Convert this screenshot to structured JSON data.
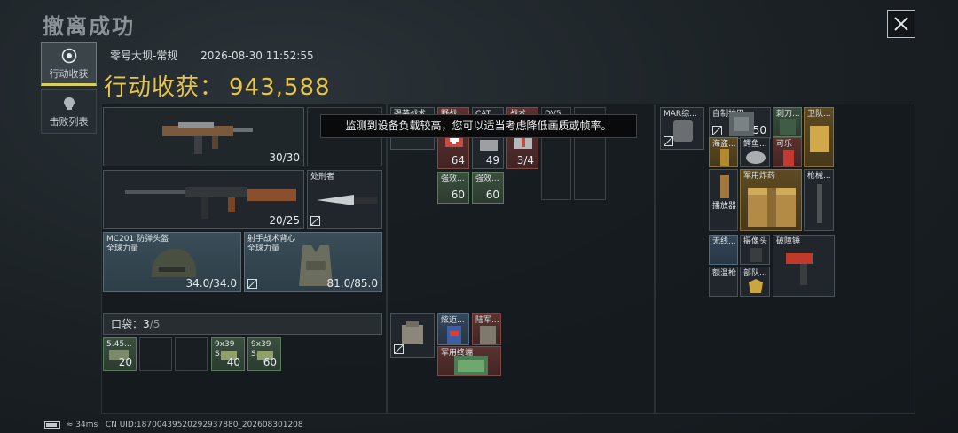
{
  "page_title": "撤离成功",
  "side_tabs": [
    {
      "label": "行动收获",
      "icon": "target-badge-icon",
      "active": true
    },
    {
      "label": "击败列表",
      "icon": "skull-icon",
      "active": false
    }
  ],
  "map_info": {
    "map": "零号大坝-常规",
    "datetime": "2026-08-30 11:52:55"
  },
  "harvest": {
    "label": "行动收获：",
    "value": "943,588"
  },
  "tooltip": "监测到设备负载较高，您可以适当考虑降低画质或帧率。",
  "weapons": [
    {
      "name": "",
      "count": "30/30",
      "icon": "smg-icon"
    },
    {
      "name": "",
      "count": "20/25",
      "icon": "rifle-icon"
    }
  ],
  "melee": {
    "name": "处刑者",
    "icon": "knife-icon"
  },
  "helmet": {
    "name": "MC201 防弹头盔",
    "sub": "全球力量",
    "count": "34.0/34.0",
    "icon": "helmet-icon"
  },
  "vest": {
    "name": "射手战术背心",
    "sub": "全球力量",
    "count": "81.0/85.0",
    "icon": "vest-icon"
  },
  "pocket": {
    "label": "口袋：",
    "current": "3",
    "max": "/5"
  },
  "pocket_items": [
    {
      "name": "5.45...",
      "count": "20"
    },
    {
      "name": "",
      "count": ""
    },
    {
      "name": "",
      "count": ""
    },
    {
      "name": "9x39 S...",
      "count": "40"
    },
    {
      "name": "9x39 S...",
      "count": "60"
    }
  ],
  "chest_items": [
    {
      "name": "强袭战术...",
      "count": ""
    },
    {
      "name": "野战...",
      "count": "64"
    },
    {
      "name": "CAT ...",
      "count": "49"
    },
    {
      "name": "战术...",
      "count": "3/4"
    },
    {
      "name": "DV5...",
      "count": ""
    },
    {
      "name": "强效...",
      "count": "60"
    },
    {
      "name": "强效...",
      "count": "60"
    }
  ],
  "bag_items": [
    {
      "name": "炫迈...",
      "count": ""
    },
    {
      "name": "陆军...",
      "count": ""
    },
    {
      "name": "军用终端",
      "count": ""
    }
  ],
  "case_items": [
    {
      "name": "MAR综...",
      "count": ""
    }
  ],
  "loot_items": [
    {
      "name": "自制护甲",
      "count": "50"
    },
    {
      "name": "刺刀...",
      "count": ""
    },
    {
      "name": "卫队...",
      "count": ""
    },
    {
      "name": "海盗...",
      "count": ""
    },
    {
      "name": "鳄鱼...",
      "count": ""
    },
    {
      "name": "可乐",
      "count": ""
    },
    {
      "name": "军用炸药",
      "count": ""
    },
    {
      "name": "枪械...",
      "count": ""
    },
    {
      "name": "播放器",
      "count": ""
    },
    {
      "name": "无线...",
      "count": ""
    },
    {
      "name": "摄像头",
      "count": ""
    },
    {
      "name": "破障锤",
      "count": ""
    },
    {
      "name": "额温枪",
      "count": ""
    },
    {
      "name": "部队...",
      "count": ""
    }
  ],
  "status_bar": {
    "ping": "34ms",
    "uid": "CN UID:18700439520292937880_202608301208"
  }
}
